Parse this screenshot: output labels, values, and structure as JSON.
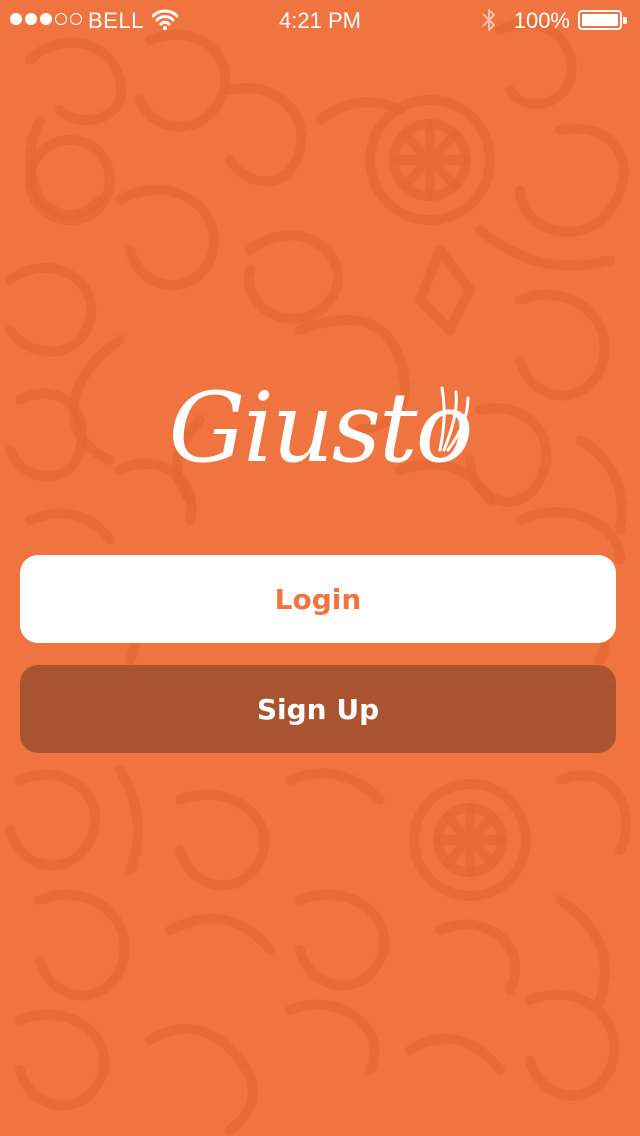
{
  "status_bar": {
    "carrier": "BELL",
    "time": "4:21 PM",
    "battery_percent": "100%",
    "signal_bars_filled": 3,
    "signal_bars_total": 5
  },
  "app": {
    "logo_text": "Giusto"
  },
  "buttons": {
    "login_label": "Login",
    "signup_label": "Sign Up"
  },
  "colors": {
    "background": "#EF7440",
    "pattern": "#E2652F",
    "login_button_bg": "#FFFFFF",
    "login_button_text": "#EF7440",
    "signup_button_bg": "#AA5331",
    "signup_button_text": "#FFFFFF"
  },
  "icons": {
    "background_pattern": "vegetable-doodle-pattern",
    "logo_mark": "sprout-leaves-icon",
    "wifi": "wifi-icon",
    "bluetooth": "bluetooth-icon",
    "battery": "battery-icon"
  }
}
